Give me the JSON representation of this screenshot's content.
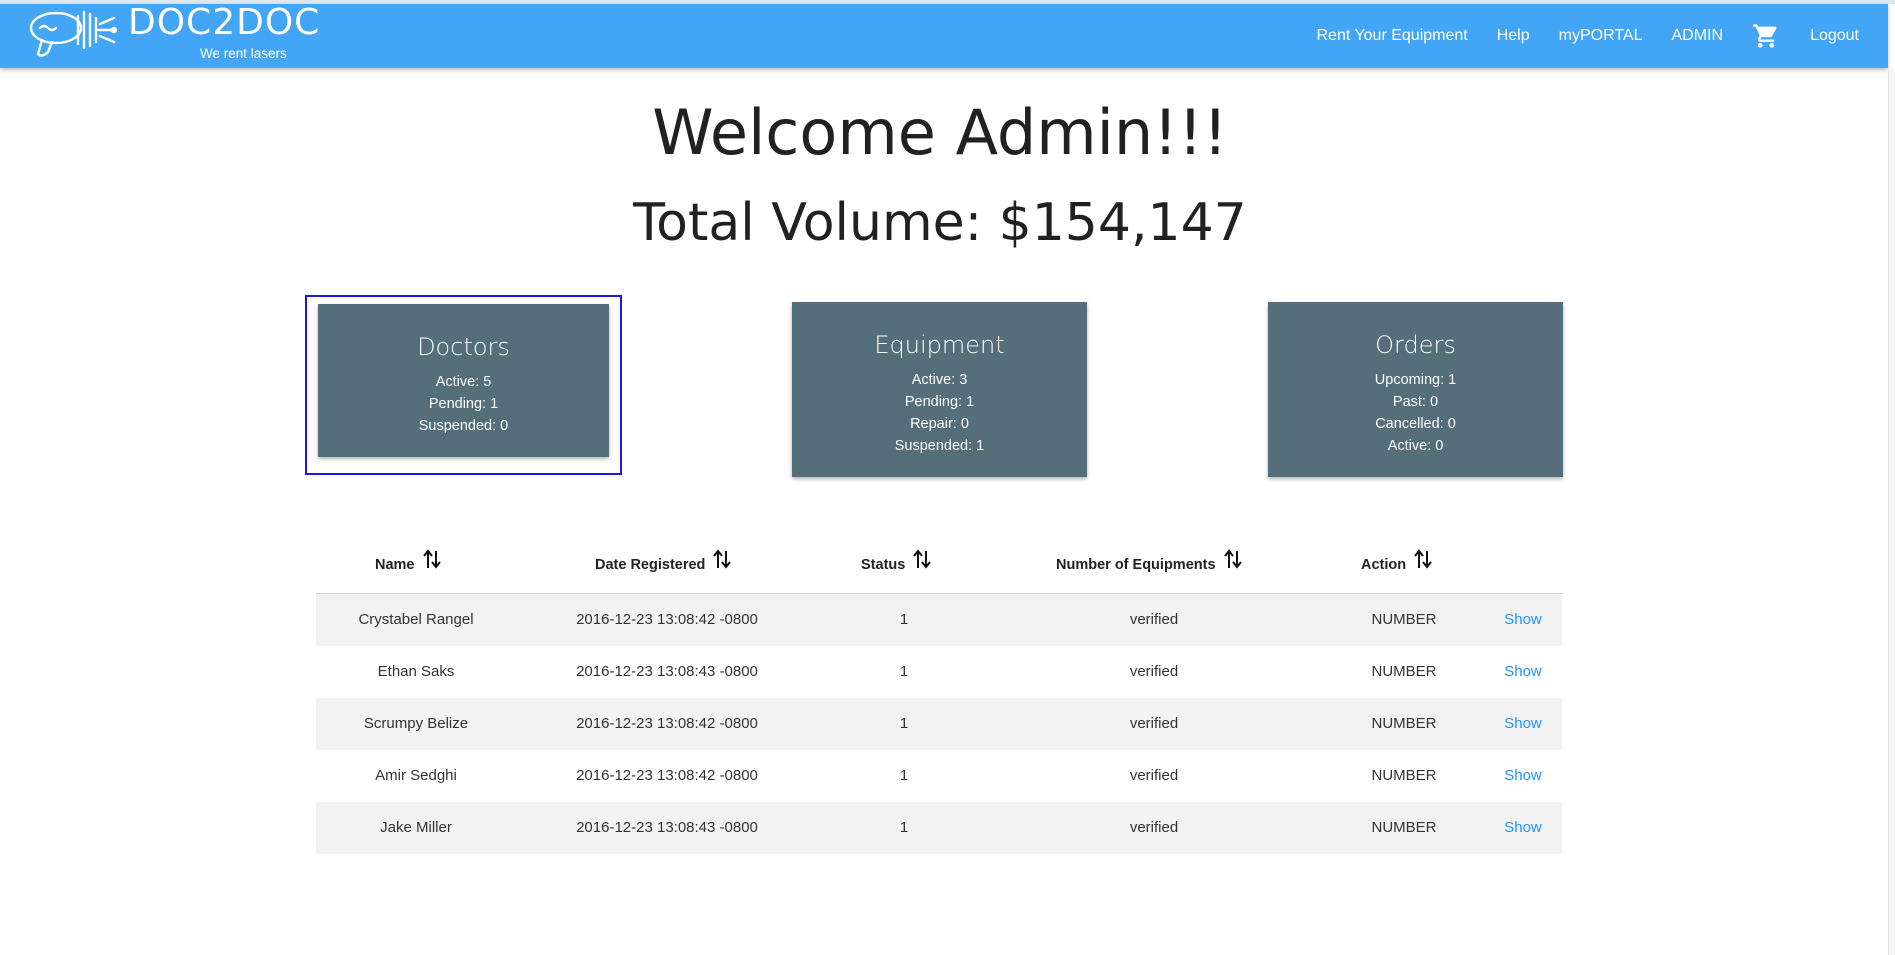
{
  "header": {
    "logo_title": "DOC2DOC",
    "logo_subtitle": "We rent lasers",
    "logo_icon": "laser-gun-icon",
    "nav": [
      {
        "label": "Rent Your Equipment"
      },
      {
        "label": "Help"
      },
      {
        "label": "myPORTAL"
      },
      {
        "label": "ADMIN"
      }
    ],
    "cart_icon": "shopping-cart-icon",
    "logout_label": "Logout"
  },
  "main": {
    "welcome": "Welcome Admin!!!",
    "total_volume": "Total Volume: $154,147"
  },
  "cards": {
    "doctors": {
      "title": "Doctors",
      "lines": [
        "Active: 5",
        "Pending: 1",
        "Suspended: 0"
      ]
    },
    "equipment": {
      "title": "Equipment",
      "lines": [
        "Active: 3",
        "Pending: 1",
        "Repair: 0",
        "Suspended: 1"
      ]
    },
    "orders": {
      "title": "Orders",
      "lines": [
        "Upcoming: 1",
        "Past: 0",
        "Cancelled: 0",
        "Active: 0"
      ]
    }
  },
  "table": {
    "headers": [
      "Name",
      "Date Registered",
      "Status",
      "Number of Equipments",
      "Action"
    ],
    "sort_icon": "sort-arrows-icon",
    "rows": [
      {
        "name": "Crystabel Rangel",
        "date": "2016-12-23 13:08:42 -0800",
        "status": "1",
        "equipments": "verified",
        "action": "NUMBER",
        "link": "Show"
      },
      {
        "name": "Ethan Saks",
        "date": "2016-12-23 13:08:43 -0800",
        "status": "1",
        "equipments": "verified",
        "action": "NUMBER",
        "link": "Show"
      },
      {
        "name": "Scrumpy Belize",
        "date": "2016-12-23 13:08:42 -0800",
        "status": "1",
        "equipments": "verified",
        "action": "NUMBER",
        "link": "Show"
      },
      {
        "name": "Amir Sedghi",
        "date": "2016-12-23 13:08:42 -0800",
        "status": "1",
        "equipments": "verified",
        "action": "NUMBER",
        "link": "Show"
      },
      {
        "name": "Jake Miller",
        "date": "2016-12-23 13:08:43 -0800",
        "status": "1",
        "equipments": "verified",
        "action": "NUMBER",
        "link": "Show"
      }
    ]
  },
  "colors": {
    "navbar": "#42a5f5",
    "card": "#546e7a",
    "link": "#2196f3",
    "row_stripe": "#f2f2f2",
    "selection_frame": "#1a1adb"
  }
}
